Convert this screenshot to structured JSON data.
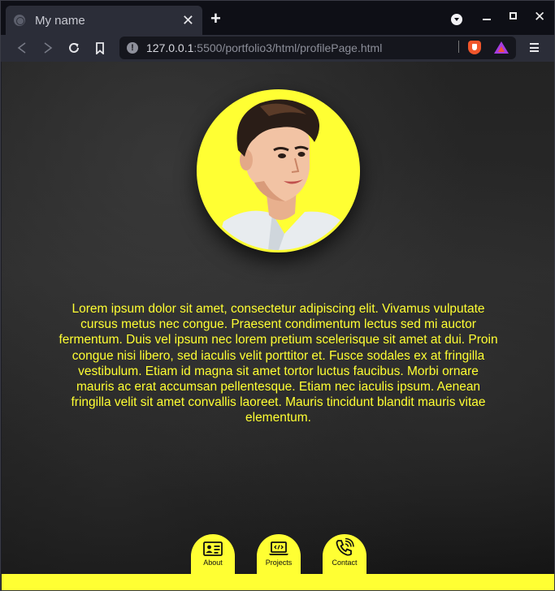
{
  "browser": {
    "tab_title": "My name",
    "url_host": "127.0.0.1",
    "url_rest": ":5500/portfolio3/html/profilePage.html"
  },
  "page": {
    "bio": "Lorem ipsum dolor sit amet, consectetur adipiscing elit. Vivamus vulputate cursus metus nec congue. Praesent condimentum lectus sed mi auctor fermentum. Duis vel ipsum nec lorem pretium scelerisque sit amet at dui. Proin congue nisi libero, sed iaculis velit porttitor et. Fusce sodales ex at fringilla vestibulum. Etiam id magna sit amet tortor luctus faucibus. Morbi ornare mauris ac erat accumsan pellentesque. Etiam nec iaculis ipsum. Aenean fringilla velit sit amet convallis laoreet. Mauris tincidunt blandit mauris vitae elementum.",
    "nav": [
      {
        "label": "About",
        "icon": "id-card-icon"
      },
      {
        "label": "Projects",
        "icon": "laptop-code-icon"
      },
      {
        "label": "Contact",
        "icon": "phone-icon"
      }
    ]
  },
  "colors": {
    "accent": "#ffff33",
    "chrome_dark": "#0e0f16",
    "toolbar": "#2b2d38"
  }
}
